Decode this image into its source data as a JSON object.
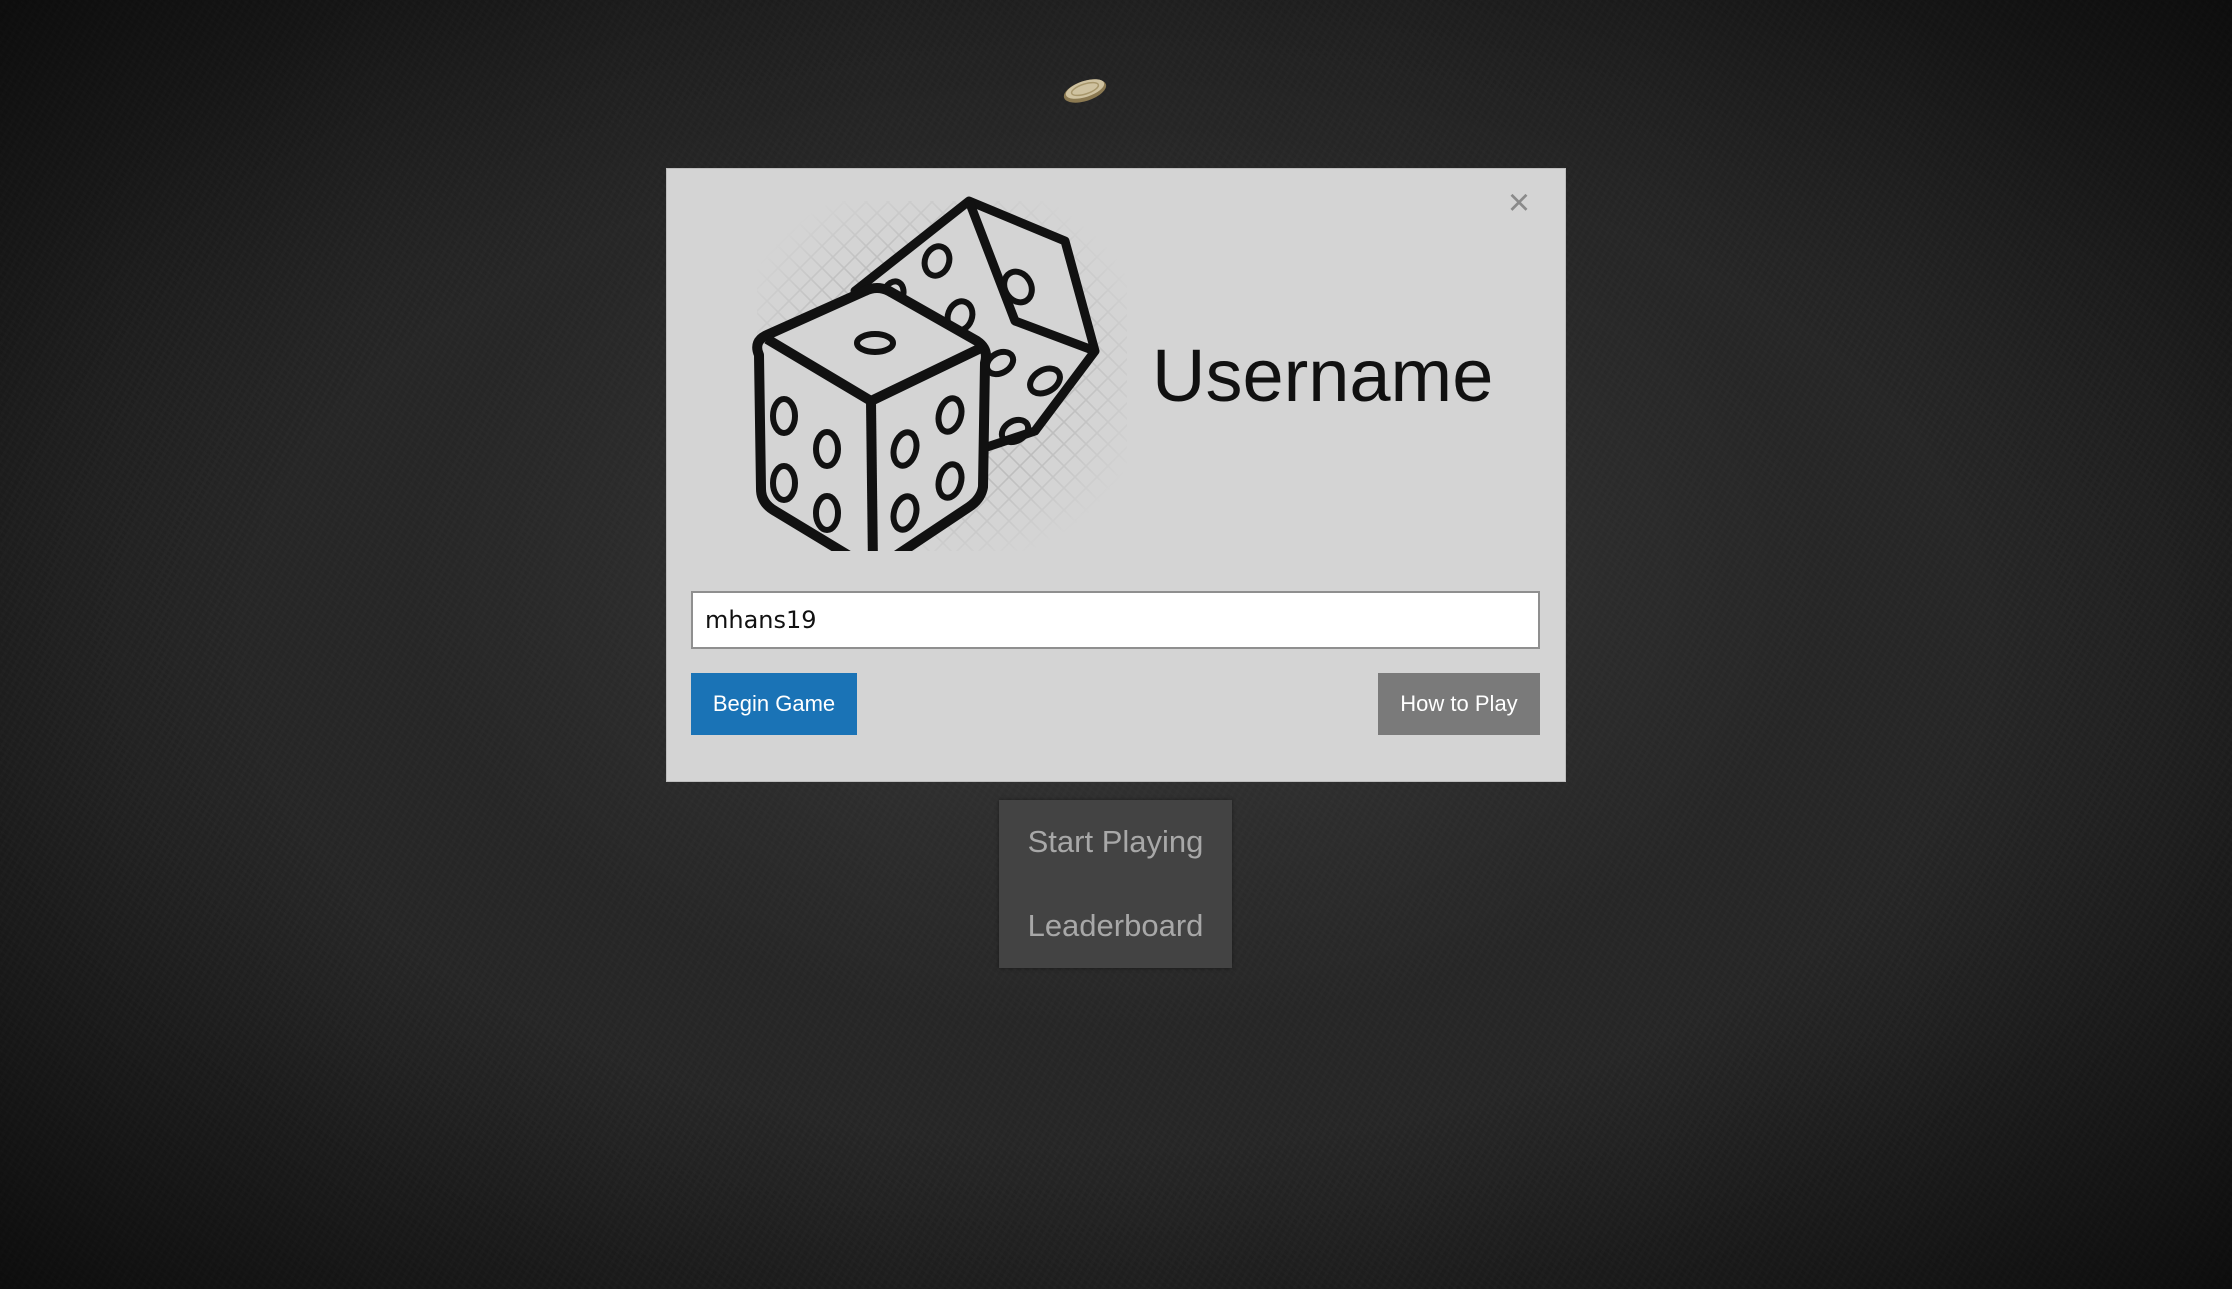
{
  "modal": {
    "title": "Username",
    "close_symbol": "×",
    "input": {
      "value": "mhans19",
      "placeholder": ""
    },
    "begin_label": "Begin Game",
    "howto_label": "How to Play"
  },
  "menu": {
    "items": [
      {
        "label": "Start Playing"
      },
      {
        "label": "Leaderboard"
      }
    ]
  },
  "icons": {
    "logo": "dice-icon",
    "coin": "coin-icon",
    "close": "close-icon"
  },
  "colors": {
    "primary_button": "#1a73b6",
    "secondary_button": "#7a7a7a",
    "modal_background": "#d4d4d4",
    "menu_background": "#434343"
  }
}
